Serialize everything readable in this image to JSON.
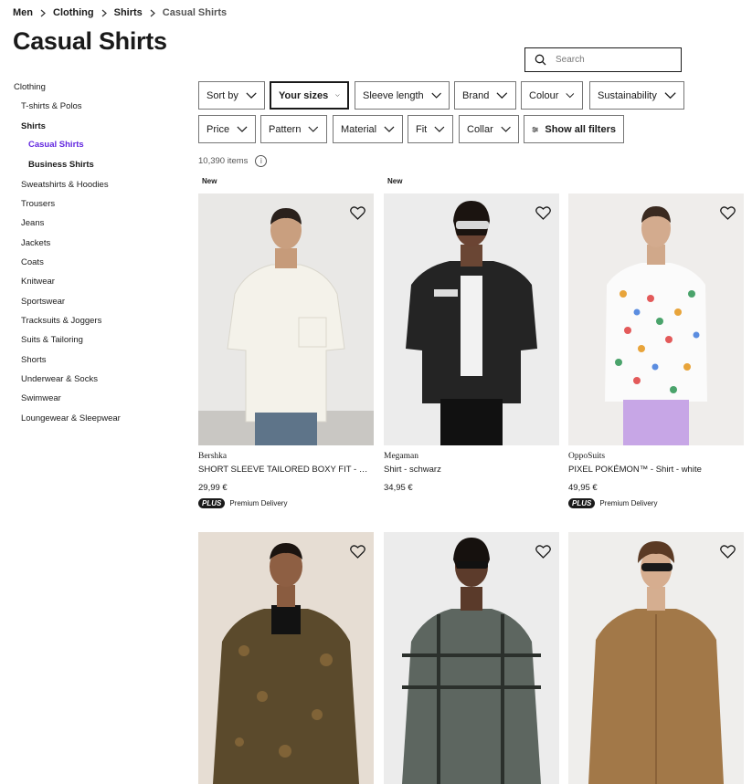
{
  "breadcrumb": [
    "Men",
    "Clothing",
    "Shirts",
    "Casual Shirts"
  ],
  "page_title": "Casual Shirts",
  "search": {
    "placeholder": "Search"
  },
  "sidebar": {
    "root": "Clothing",
    "items": [
      {
        "label": "T-shirts & Polos"
      },
      {
        "label": "Shirts"
      },
      {
        "label": "Casual Shirts"
      },
      {
        "label": "Business Shirts"
      },
      {
        "label": "Sweatshirts & Hoodies"
      },
      {
        "label": "Trousers"
      },
      {
        "label": "Jeans"
      },
      {
        "label": "Jackets"
      },
      {
        "label": "Coats"
      },
      {
        "label": "Knitwear"
      },
      {
        "label": "Sportswear"
      },
      {
        "label": "Tracksuits & Joggers"
      },
      {
        "label": "Suits & Tailoring"
      },
      {
        "label": "Shorts"
      },
      {
        "label": "Underwear & Socks"
      },
      {
        "label": "Swimwear"
      },
      {
        "label": "Loungewear & Sleepwear"
      }
    ]
  },
  "filters": {
    "row1": [
      "Sort by",
      "Your sizes",
      "Sleeve length",
      "Brand",
      "Colour",
      "Sustainability"
    ],
    "row2": [
      "Price",
      "Pattern",
      "Material",
      "Fit",
      "Collar"
    ],
    "show_all": "Show all filters"
  },
  "item_count": "10,390 items",
  "colors": {
    "accent": "#6328e0",
    "text": "#1a1a1a"
  },
  "products": [
    {
      "brand": "Bershka",
      "name": "SHORT SLEEVE TAILORED BOXY FIT - Shirt - white",
      "price": "29,99 €",
      "badge": "New",
      "plus": "PLUS",
      "delivery": "Premium Delivery"
    },
    {
      "brand": "Megaman",
      "name": "Shirt - schwarz",
      "price": "34,95 €",
      "badge": "New"
    },
    {
      "brand": "OppoSuits",
      "name": "PIXEL POKÉMON™ - Shirt - white",
      "price": "49,95 €",
      "plus": "PLUS",
      "delivery": "Premium Delivery"
    },
    {},
    {},
    {}
  ]
}
